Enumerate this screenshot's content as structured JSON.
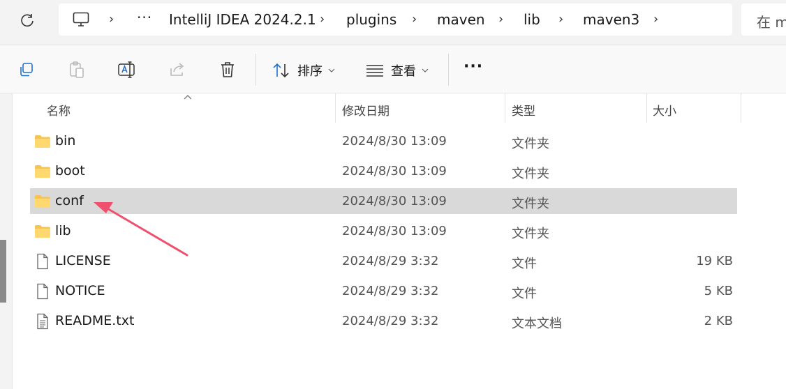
{
  "address_bar": {
    "crumbs": [
      "IntelliJ IDEA 2024.2.1",
      "plugins",
      "maven",
      "lib",
      "maven3"
    ],
    "search_text": "在 m"
  },
  "command_bar": {
    "sort_label": "排序",
    "view_label": "查看"
  },
  "columns": {
    "name": "名称",
    "modified": "修改日期",
    "type": "类型",
    "size": "大小"
  },
  "rows": [
    {
      "name": "bin",
      "modified": "2024/8/30 13:09",
      "type": "文件夹",
      "size": "",
      "kind": "folder-icon"
    },
    {
      "name": "boot",
      "modified": "2024/8/30 13:09",
      "type": "文件夹",
      "size": "",
      "kind": "folder-icon"
    },
    {
      "name": "conf",
      "modified": "2024/8/30 13:09",
      "type": "文件夹",
      "size": "",
      "kind": "folder-icon",
      "selected": true
    },
    {
      "name": "lib",
      "modified": "2024/8/30 13:09",
      "type": "文件夹",
      "size": "",
      "kind": "folder-icon"
    },
    {
      "name": "LICENSE",
      "modified": "2024/8/29 3:32",
      "type": "文件",
      "size": "19 KB",
      "kind": "file-icon"
    },
    {
      "name": "NOTICE",
      "modified": "2024/8/29 3:32",
      "type": "文件",
      "size": "5 KB",
      "kind": "file-icon"
    },
    {
      "name": "README.txt",
      "modified": "2024/8/29 3:32",
      "type": "文本文档",
      "size": "2 KB",
      "kind": "text-file-icon"
    }
  ],
  "colors": {
    "selection": "#d9d9d9",
    "folder": "#f6c453",
    "annotation_arrow": "#f0506e"
  }
}
